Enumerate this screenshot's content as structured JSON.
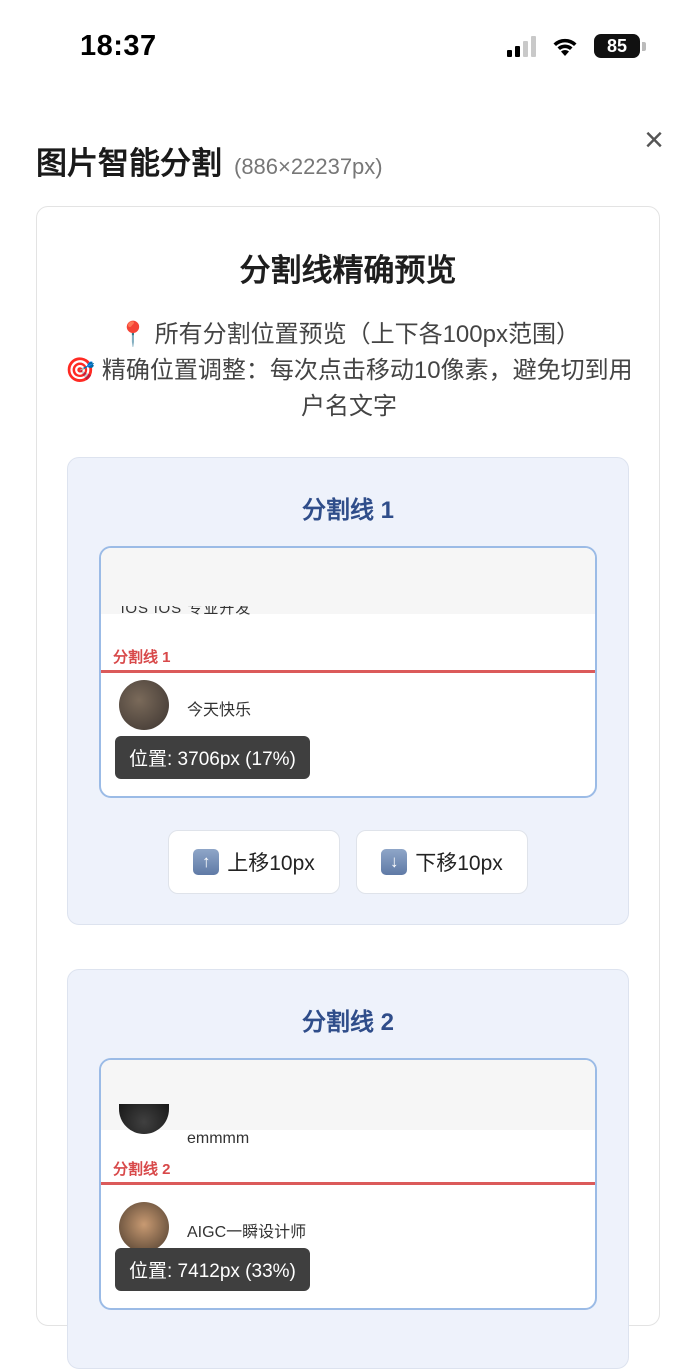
{
  "status_bar": {
    "time": "18:37",
    "battery": "85"
  },
  "header": {
    "title": "图片智能分割",
    "dimensions": "(886×22237px)",
    "close_icon": "×"
  },
  "card": {
    "title": "分割线精确预览",
    "desc_line1_icon": "📍",
    "desc_line1": "所有分割位置预览（上下各100px范围）",
    "desc_line2_icon": "🎯",
    "desc_line2": "精确位置调整：每次点击移动10像素，避免切到用户名文字"
  },
  "splits": [
    {
      "title": "分割线 1",
      "cut_text": "iOS  iOS 专业开发",
      "label": "分割线 1",
      "user_below": "今天快乐",
      "position": "位置: 3706px (17%)",
      "up_label": "上移10px",
      "down_label": "下移10px"
    },
    {
      "title": "分割线 2",
      "user_above": "emmmm",
      "label": "分割线 2",
      "user_below": "AIGC一瞬设计师",
      "position": "位置: 7412px (33%)"
    }
  ],
  "icons": {
    "up": "↑",
    "down": "↓"
  }
}
